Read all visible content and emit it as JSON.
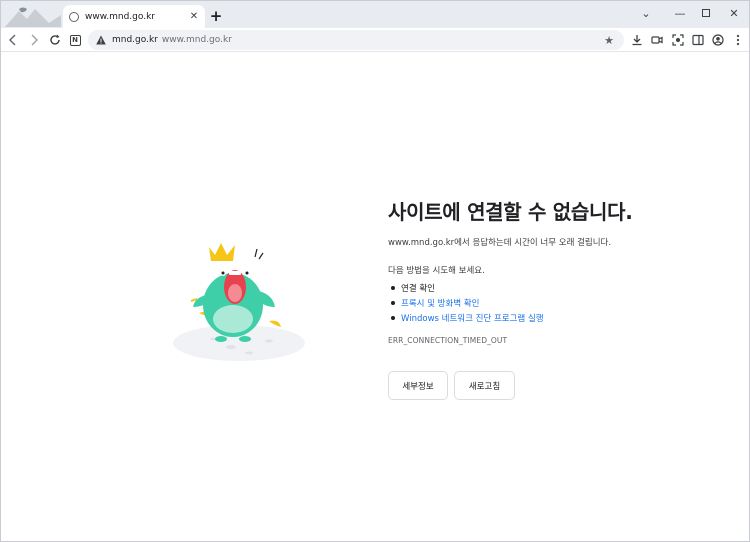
{
  "browser": {
    "tab_title": "www.mnd.go.kr",
    "omnibox_host": "mnd.go.kr",
    "omnibox_url": "www.mnd.go.kr"
  },
  "error": {
    "title": "사이트에 연결할 수 없습니다.",
    "description": "www.mnd.go.kr에서 응답하는데 시간이 너무 오래 걸립니다.",
    "try_heading": "다음 방법을 시도해 보세요.",
    "suggestions": [
      {
        "text": "연결 확인",
        "is_link": false
      },
      {
        "text": "프록시 및 방화벽 확인",
        "is_link": true
      },
      {
        "text": "Windows 네트워크 진단 프로그램 실행",
        "is_link": true
      }
    ],
    "code": "ERR_CONNECTION_TIMED_OUT",
    "details_button": "세부정보",
    "reload_button": "새로고침"
  },
  "colors": {
    "link": "#1a73e8",
    "dino_body": "#3ecfa8",
    "crown": "#f5c518",
    "mouth": "#e8424e"
  }
}
